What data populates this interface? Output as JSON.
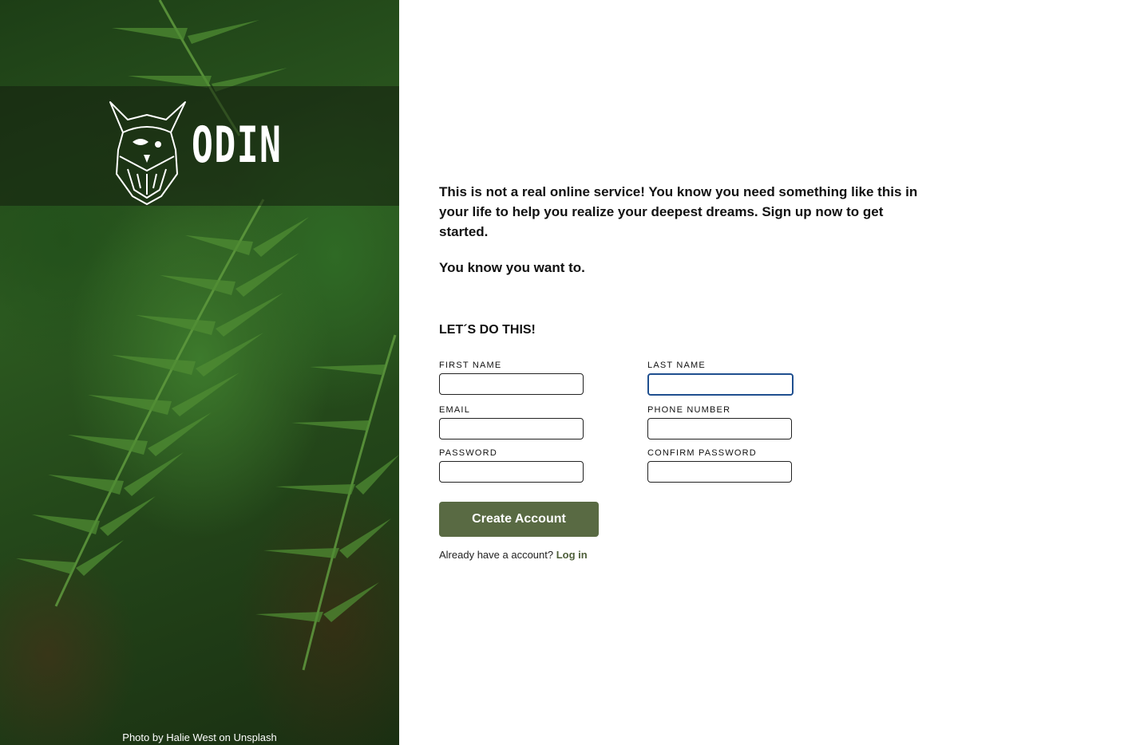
{
  "hero": {
    "brand_name": "ODIN",
    "photo_credit": "Photo by Halie West on Unsplash"
  },
  "intro": {
    "paragraph_1": "This is not a real online service! You know you need something like this in your life to help you realize your deepest dreams. Sign up now to get started.",
    "paragraph_2": "You know you want to."
  },
  "form": {
    "heading": "LET´S DO THIS!",
    "fields": {
      "first_name": {
        "label": "FIRST NAME",
        "value": ""
      },
      "last_name": {
        "label": "LAST NAME",
        "value": ""
      },
      "email": {
        "label": "EMAIL",
        "value": ""
      },
      "phone": {
        "label": "PHONE NUMBER",
        "value": ""
      },
      "password": {
        "label": "PASSWORD",
        "value": ""
      },
      "confirm_password": {
        "label": "CONFIRM PASSWORD",
        "value": ""
      }
    },
    "submit_label": "Create Account",
    "login_prompt": "Already have a account?",
    "login_link": "Log in"
  },
  "colors": {
    "accent": "#596a43",
    "link": "#4e5f3a",
    "focus_border": "#1f4f8f"
  },
  "icons": {
    "logo": "viking-head-icon"
  }
}
